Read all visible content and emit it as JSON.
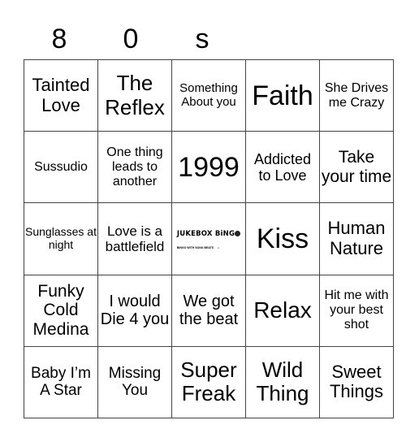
{
  "title_letters": [
    "8",
    "0",
    "s",
    "",
    ""
  ],
  "grid": {
    "cells": [
      [
        "Tainted Love",
        "The Reflex",
        "Something About you",
        "Faith",
        "She Drives me Crazy"
      ],
      [
        "Sussudio",
        "One thing leads to another",
        "1999",
        "Addicted to Love",
        "Take your time"
      ],
      [
        "Sunglasses at night",
        "Love is a battlefield",
        "",
        "Kiss",
        "Human Nature"
      ],
      [
        "Funky Cold Medina",
        "I would Die 4 you",
        "We got the beat",
        "Relax",
        "Hit me with your best shot"
      ],
      [
        "Baby I’m A Star",
        "Missing You",
        "Super Freak",
        "Wild Thing",
        "Sweet Things"
      ]
    ],
    "free_space": {
      "logo_text_left": "JUKEBOX B",
      "logo_text_right": "NG",
      "logo_subtitle": "BINGO WITH SONG BEATS",
      "icon": "music-note-icon"
    }
  }
}
